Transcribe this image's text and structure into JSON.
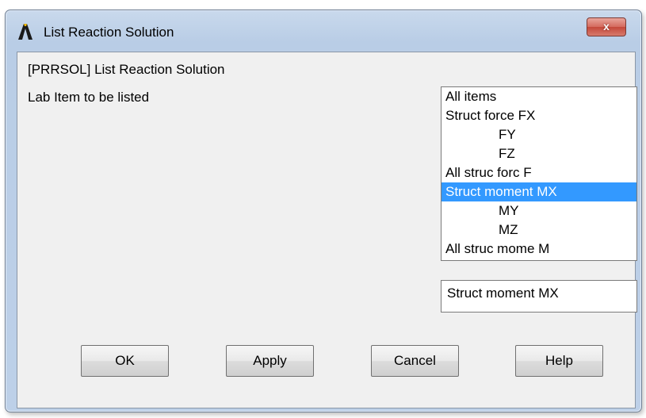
{
  "window": {
    "title": "List Reaction Solution",
    "app_icon": "ansys-logo-icon",
    "close_label": "x"
  },
  "dialog": {
    "heading": "[PRRSOL]  List Reaction Solution",
    "lab_label": "Lab   Item to be listed"
  },
  "list": {
    "items": [
      {
        "label": "All items",
        "indent": false
      },
      {
        "label": "Struct force  FX",
        "indent": false
      },
      {
        "label": "FY",
        "indent": true
      },
      {
        "label": "FZ",
        "indent": true
      },
      {
        "label": "All struc forc F",
        "indent": false
      },
      {
        "label": "Struct moment MX",
        "indent": false,
        "selected": true
      },
      {
        "label": "MY",
        "indent": true
      },
      {
        "label": "MZ",
        "indent": true
      },
      {
        "label": "All struc mome M",
        "indent": false
      }
    ],
    "selected_value": "Struct moment MX"
  },
  "buttons": {
    "ok": "OK",
    "apply": "Apply",
    "cancel": "Cancel",
    "help": "Help"
  },
  "colors": {
    "selection": "#3399ff",
    "close_button": "#c4483a"
  }
}
